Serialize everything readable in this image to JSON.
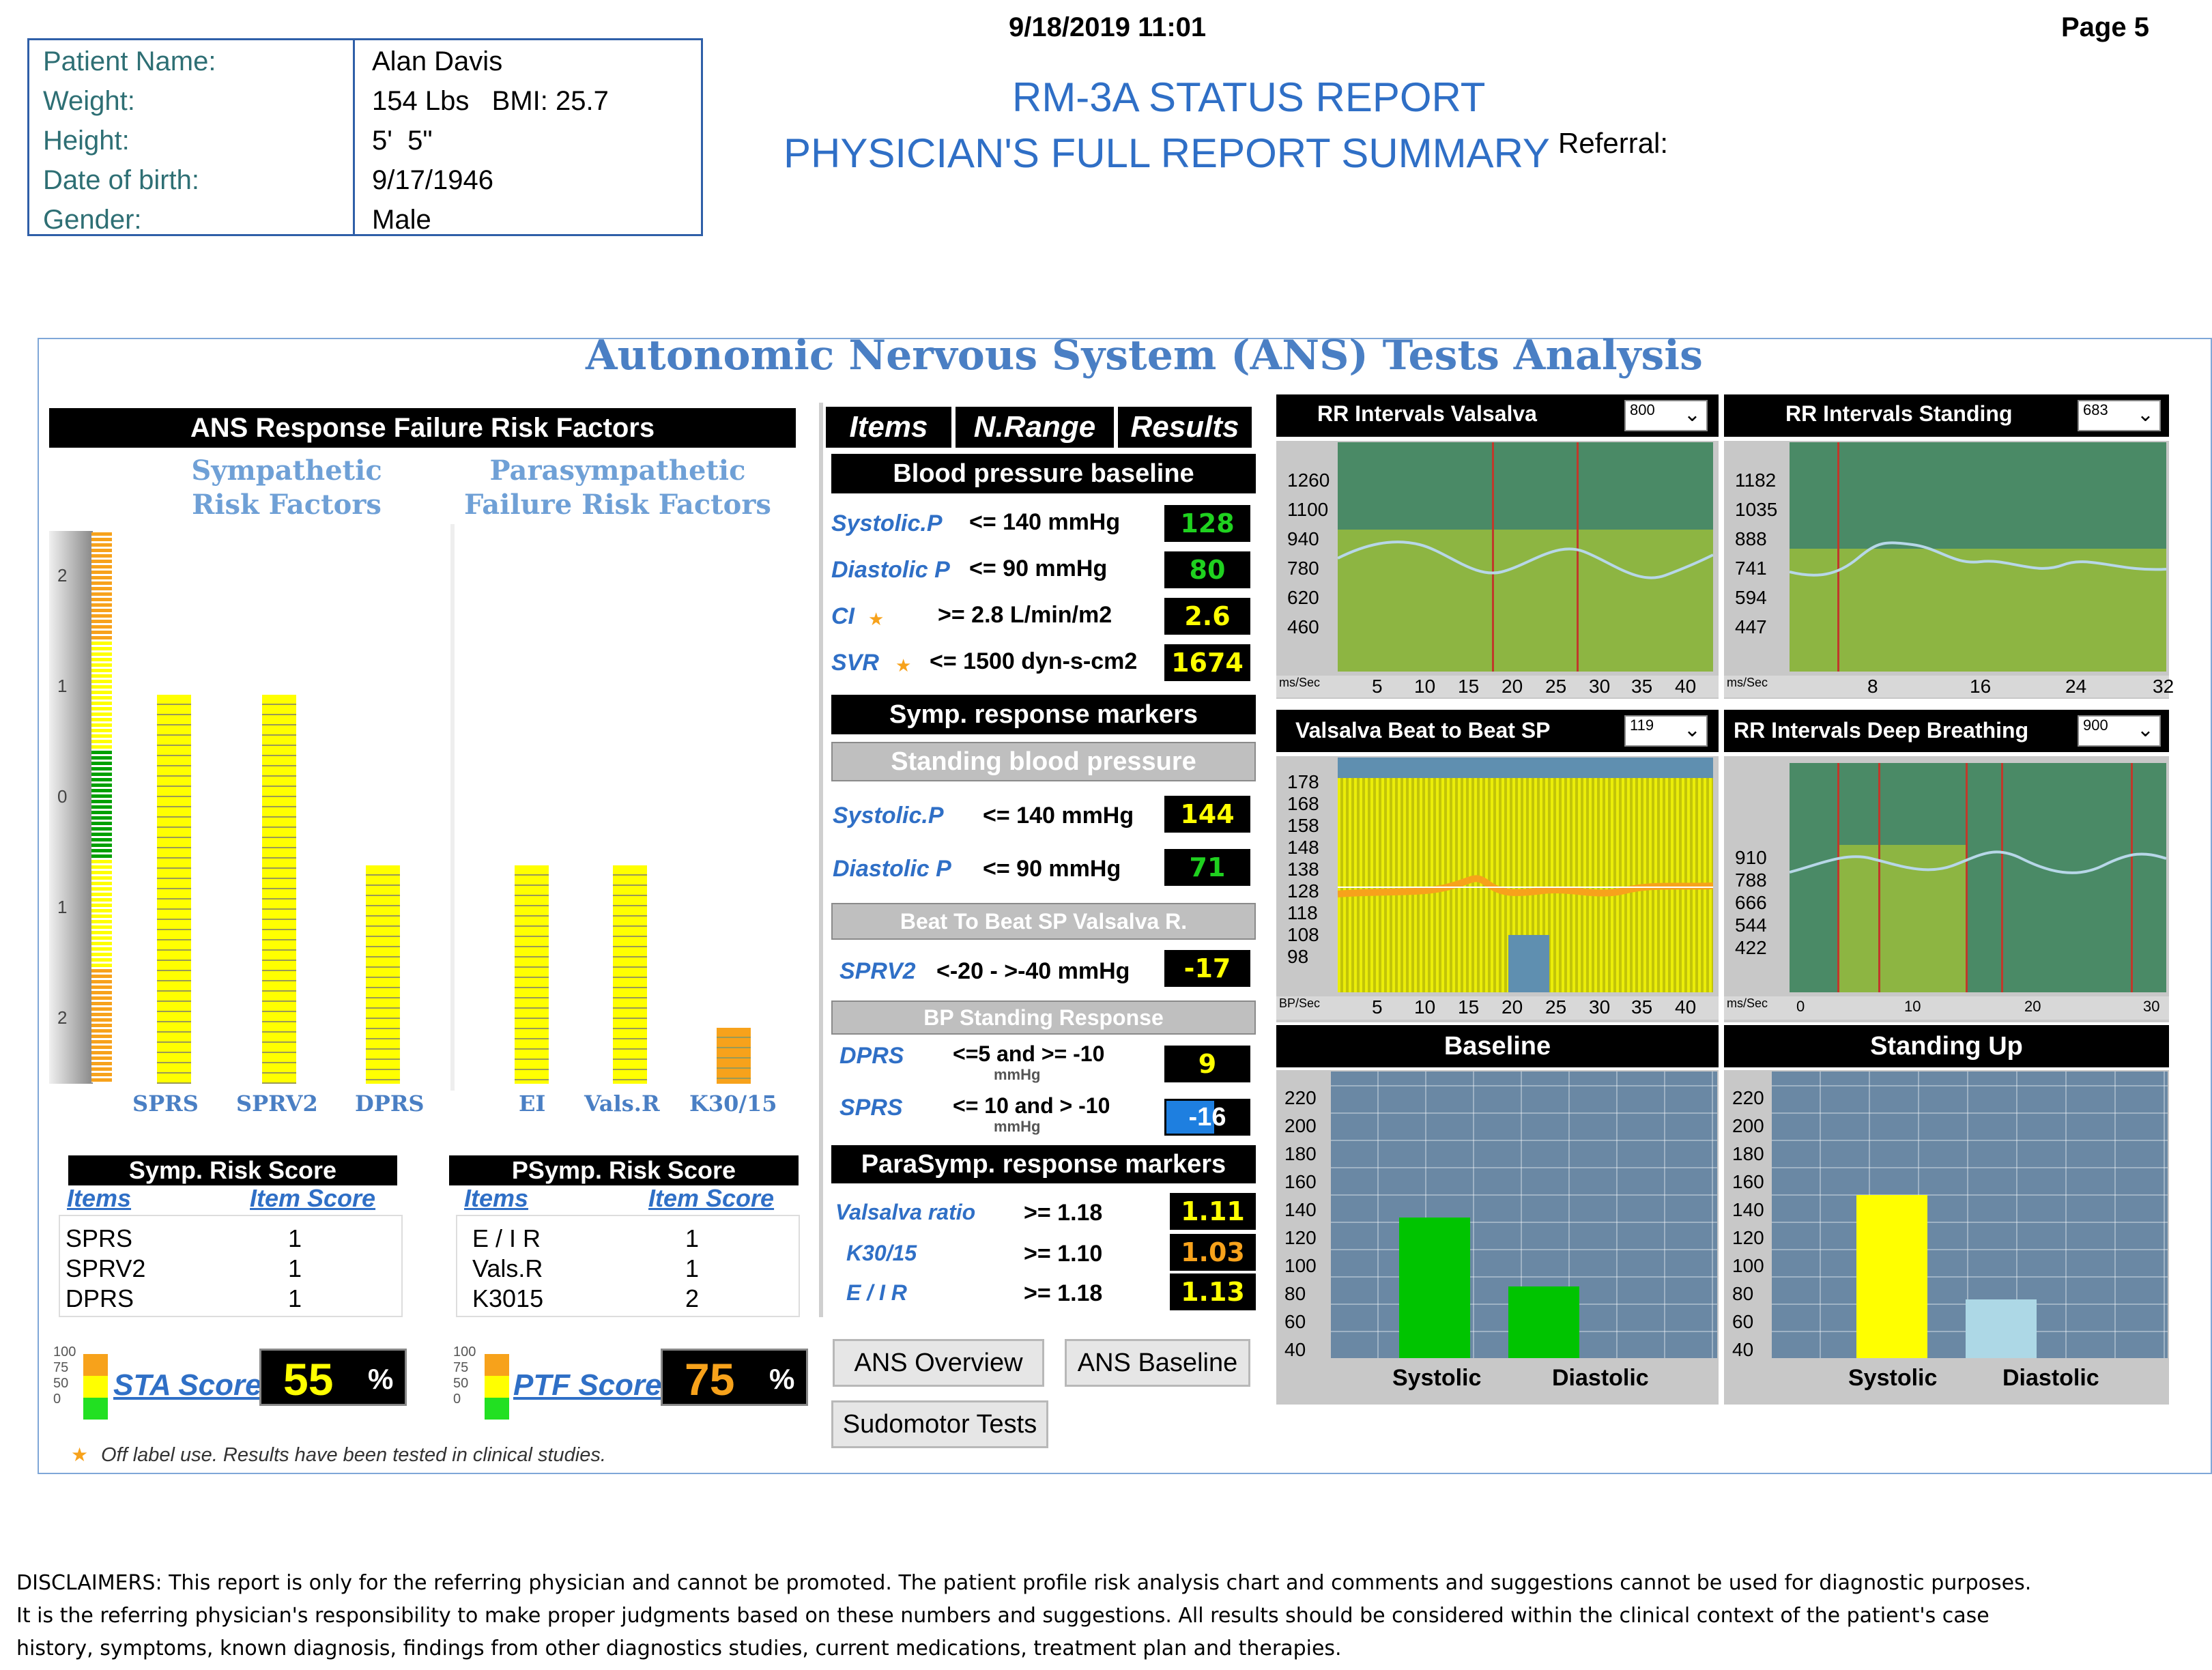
{
  "header": {
    "datetime": "9/18/2019  11:01",
    "page": "Page 5",
    "title1": "RM-3A STATUS REPORT",
    "title2": "PHYSICIAN'S FULL REPORT SUMMARY",
    "referral_label": "Referral:"
  },
  "patient": {
    "rows": [
      {
        "label": "Patient Name:",
        "value": "Alan Davis"
      },
      {
        "label": "Weight:",
        "value": "154 Lbs   BMI: 25.7"
      },
      {
        "label": "Height:",
        "value": "5'  5\""
      },
      {
        "label": "Date of birth:",
        "value": "9/17/1946"
      },
      {
        "label": "Gender:",
        "value": "Male"
      }
    ]
  },
  "panel": {
    "title": "Autonomic Nervous System (ANS) Tests Analysis",
    "risk": {
      "heading": "ANS Response Failure Risk Factors",
      "symp_header_1": "Sympathetic",
      "symp_header_2": "Risk Factors",
      "para_header_1": "Parasympathetic",
      "para_header_2": "Failure Risk Factors",
      "scale_labels": [
        "2",
        "1",
        "0",
        "1",
        "2"
      ],
      "bars": [
        {
          "label": "SPRS",
          "value": 1,
          "color": "#ffff00"
        },
        {
          "label": "SPRV2",
          "value": 1,
          "color": "#ffff00"
        },
        {
          "label": "DPRS",
          "value": 1,
          "color": "#ffff00"
        },
        {
          "label": "EI",
          "value": 1,
          "color": "#ffff00"
        },
        {
          "label": "Vals.R",
          "value": 1,
          "color": "#ffff00"
        },
        {
          "label": "K30/15",
          "value": 2,
          "color": "#f7a21b"
        }
      ]
    },
    "symp_score": {
      "title": "Symp. Risk Score",
      "col1": "Items",
      "col2": "Item Score",
      "rows": [
        {
          "item": "SPRS",
          "score": "1"
        },
        {
          "item": "SPRV2",
          "score": "1"
        },
        {
          "item": "DPRS",
          "score": "1"
        }
      ],
      "score_label": "STA Score",
      "score_value": "55",
      "percent": "%"
    },
    "psymp_score": {
      "title": "PSymp. Risk Score",
      "col1": "Items",
      "col2": "Item Score",
      "rows": [
        {
          "item": "E / I R",
          "score": "1"
        },
        {
          "item": "Vals.R",
          "score": "1"
        },
        {
          "item": "K3015",
          "score": "2"
        }
      ],
      "score_label": "PTF Score",
      "score_value": "75",
      "percent": "%"
    },
    "gauge_ticks": [
      "100",
      "75",
      "50",
      "0"
    ],
    "footnote": "Off label use. Results have been tested in clinical studies.",
    "table": {
      "col_items": "Items",
      "col_range": "N.Range",
      "col_results": "Results",
      "bp_baseline": "Blood pressure baseline",
      "baseline_rows": [
        {
          "item": "Systolic.P",
          "range": "<= 140 mmHg",
          "value": "128",
          "color": "#1fd11f",
          "star": ""
        },
        {
          "item": "Diastolic P",
          "range": "<= 90 mmHg",
          "value": "80",
          "color": "#1fd11f",
          "star": ""
        },
        {
          "item": "CI",
          "range": ">= 2.8 L/min/m2",
          "value": "2.6",
          "color": "#ffff00",
          "star": "★"
        },
        {
          "item": "SVR",
          "range": "<= 1500 dyn-s-cm2",
          "value": "1674",
          "color": "#ffff00",
          "star": "★"
        }
      ],
      "symp_markers": "Symp. response markers",
      "standing_bp": "Standing blood pressure",
      "standing_rows": [
        {
          "item": "Systolic.P",
          "range": "<= 140 mmHg",
          "value": "144",
          "color": "#ffff00"
        },
        {
          "item": "Diastolic P",
          "range": "<= 90 mmHg",
          "value": "71",
          "color": "#1fd11f"
        }
      ],
      "b2b_header": "Beat To Beat SP Valsalva R.",
      "sprv2": {
        "item": "SPRV2",
        "range": "<-20 - >-40 mmHg",
        "value": "-17",
        "color": "#ffff00"
      },
      "bp_standing_resp": "BP Standing Response",
      "dprs": {
        "item": "DPRS",
        "range": "<=5 and >= -10",
        "unit": "mmHg",
        "value": "9",
        "color": "#ffff00"
      },
      "sprs": {
        "item": "SPRS",
        "range": "<= 10 and > -10",
        "unit": "mmHg",
        "value": "-16",
        "color": "#ffffff"
      },
      "parasymp_markers": "ParaSymp. response markers",
      "para_rows": [
        {
          "item": "Valsalva ratio",
          "range": ">= 1.18",
          "value": "1.11",
          "color": "#ffff00"
        },
        {
          "item": "K30/15",
          "range": ">= 1.10",
          "value": "1.03",
          "color": "#f7a21b"
        },
        {
          "item": "E / I R",
          "range": ">= 1.18",
          "value": "1.13",
          "color": "#ffff00"
        }
      ]
    },
    "buttons": {
      "overview": "ANS Overview",
      "baseline": "ANS Baseline",
      "sudomotor": "Sudomotor Tests"
    },
    "charts": {
      "rr_valsalva": {
        "title": "RR Intervals Valsalva",
        "dropdown": "800",
        "y": [
          "1260",
          "1100",
          "940",
          "780",
          "620",
          "460"
        ],
        "x": [
          "5",
          "10",
          "15",
          "20",
          "25",
          "30",
          "35",
          "40"
        ],
        "unit": "ms/Sec"
      },
      "rr_standing": {
        "title": "RR Intervals Standing",
        "dropdown": "683",
        "y": [
          "1182",
          "1035",
          "888",
          "741",
          "594",
          "447"
        ],
        "x": [
          "8",
          "16",
          "24",
          "32"
        ],
        "unit": "ms/Sec"
      },
      "valsalva_b2b": {
        "title": "Valsalva Beat to Beat SP",
        "dropdown": "119",
        "y": [
          "178",
          "168",
          "158",
          "148",
          "138",
          "128",
          "118",
          "108",
          "98"
        ],
        "x": [
          "5",
          "10",
          "15",
          "20",
          "25",
          "30",
          "35",
          "40"
        ],
        "unit": "BP/Sec"
      },
      "rr_deep": {
        "title": "RR Intervals Deep Breathing",
        "dropdown": "900",
        "y": [
          "910",
          "788",
          "666",
          "544",
          "422"
        ],
        "x": [
          "0",
          "10",
          "20",
          "30"
        ],
        "unit": "ms/Sec"
      },
      "baseline": {
        "title": "Baseline",
        "y": [
          "220",
          "200",
          "180",
          "160",
          "140",
          "120",
          "100",
          "80",
          "60",
          "40"
        ],
        "categories": [
          "Systolic",
          "Diastolic"
        ],
        "values": [
          128,
          80
        ],
        "colors": [
          "#00c400",
          "#00c400"
        ]
      },
      "standing": {
        "title": "Standing Up",
        "y": [
          "220",
          "200",
          "180",
          "160",
          "140",
          "120",
          "100",
          "80",
          "60",
          "40"
        ],
        "categories": [
          "Systolic",
          "Diastolic"
        ],
        "values": [
          144,
          71
        ],
        "colors": [
          "#ffff00",
          "#add8e6"
        ]
      }
    }
  },
  "disclaimer": {
    "line1": "DISCLAIMERS: This report is only for the referring physician and cannot be promoted. The patient profile risk analysis chart and comments and suggestions cannot be used for diagnostic purposes.",
    "line2": "It is the referring physician's responsibility to make proper judgments based on these numbers and suggestions. All results should be considered within the clinical context of the patient's case",
    "line3": "history, symptoms, known diagnosis, findings from other diagnostics studies, current medications, treatment plan and therapies."
  }
}
